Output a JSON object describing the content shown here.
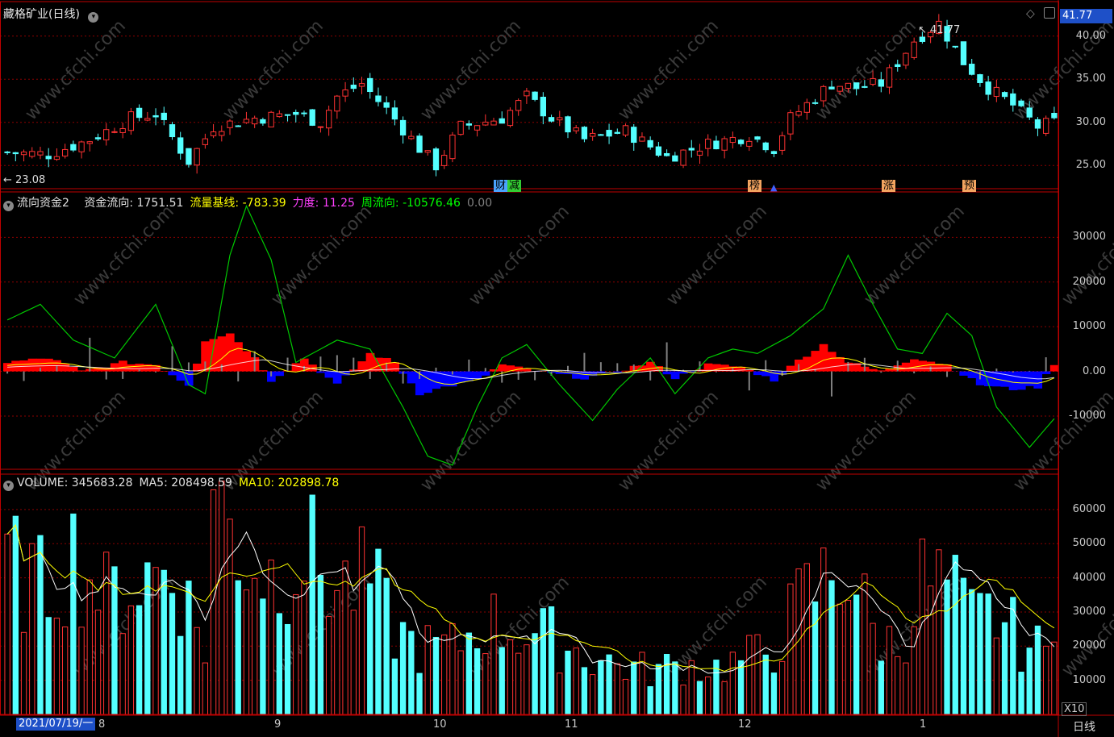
{
  "app": {
    "stock_title": "藏格矿业(日线)",
    "period_label": "日线",
    "zoom_label": "X10",
    "current_date": "2021/07/19/一",
    "watermark": "www.cfchi.com"
  },
  "price_panel": {
    "high_label": "41.77",
    "low_label": "23.08",
    "last_price_box": "41.77",
    "axis_ticks": [
      "40.00",
      "35.00",
      "30.00",
      "25.00"
    ],
    "markers": [
      {
        "text": "财",
        "color": "#4aa3ff"
      },
      {
        "text": "减",
        "color": "#33cc33"
      },
      {
        "text": "榜",
        "color": "#f4a460"
      },
      {
        "text": "涨",
        "color": "#f4a460"
      },
      {
        "text": "预",
        "color": "#f4a460"
      }
    ]
  },
  "flow_panel": {
    "title": "流向资金2",
    "items": [
      {
        "label": "资金流向: 1751.51",
        "color": "#e0e0e0"
      },
      {
        "label": "流量基线: -783.39",
        "color": "#ffff00"
      },
      {
        "label": "力度: 11.25",
        "color": "#ff40ff"
      },
      {
        "label": "周流向: -10576.46",
        "color": "#00ff00"
      },
      {
        "label": "0.00",
        "color": "#808080"
      }
    ],
    "axis_ticks": [
      "30000",
      "20000",
      "10000",
      "0.00",
      "-10000"
    ]
  },
  "volume_panel": {
    "items": [
      {
        "label": "VOLUME: 345683.28",
        "color": "#e0e0e0"
      },
      {
        "label": "MA5: 208498.59",
        "color": "#e0e0e0"
      },
      {
        "label": "MA10: 202898.78",
        "color": "#ffff00"
      }
    ],
    "axis_ticks": [
      "60000",
      "50000",
      "40000",
      "30000",
      "20000",
      "10000"
    ]
  },
  "x_axis": {
    "labels": [
      "8",
      "9",
      "10",
      "11",
      "12",
      "1"
    ]
  },
  "colors": {
    "up": "#ff3232",
    "down": "#54ffff",
    "grid": "#8b0000",
    "border": "#c00000",
    "flow_pos": "#ff0000",
    "flow_neg": "#0000ff",
    "week_line": "#00c800",
    "base_line": "#ffff00",
    "power_line": "#ffffff",
    "bars_gray": "#808080"
  },
  "chart_data": {
    "type": "candlestick",
    "n": 128,
    "price_range": [
      23.08,
      41.77
    ],
    "price_trend": [
      [
        0,
        26.5
      ],
      [
        5,
        26.3
      ],
      [
        10,
        28.0
      ],
      [
        15,
        30.5
      ],
      [
        18,
        31.0
      ],
      [
        22,
        25.5
      ],
      [
        25,
        29.5
      ],
      [
        30,
        30.5
      ],
      [
        35,
        31.0
      ],
      [
        38,
        30.0
      ],
      [
        40,
        33.0
      ],
      [
        43,
        34.5
      ],
      [
        46,
        31.5
      ],
      [
        50,
        27.0
      ],
      [
        52,
        25.0
      ],
      [
        55,
        29.5
      ],
      [
        60,
        30.5
      ],
      [
        63,
        33.0
      ],
      [
        66,
        30.5
      ],
      [
        70,
        28.0
      ],
      [
        75,
        29.0
      ],
      [
        80,
        26.0
      ],
      [
        85,
        27.5
      ],
      [
        90,
        28.5
      ],
      [
        93,
        27.0
      ],
      [
        95,
        30.5
      ],
      [
        100,
        34.5
      ],
      [
        103,
        34.0
      ],
      [
        106,
        34.5
      ],
      [
        110,
        39.5
      ],
      [
        113,
        41.5
      ],
      [
        116,
        37.0
      ],
      [
        119,
        34.0
      ],
      [
        122,
        32.0
      ],
      [
        125,
        29.5
      ],
      [
        127,
        30.0
      ]
    ],
    "flow_trend": [
      [
        0,
        2000
      ],
      [
        5,
        3000
      ],
      [
        9,
        0
      ],
      [
        14,
        2000
      ],
      [
        18,
        1500
      ],
      [
        22,
        -3000
      ],
      [
        24,
        7000
      ],
      [
        27,
        8500
      ],
      [
        30,
        3000
      ],
      [
        32,
        -2000
      ],
      [
        36,
        3000
      ],
      [
        40,
        -3000
      ],
      [
        44,
        4000
      ],
      [
        47,
        2000
      ],
      [
        50,
        -5000
      ],
      [
        53,
        -3500
      ],
      [
        57,
        -2000
      ],
      [
        60,
        1500
      ],
      [
        64,
        0
      ],
      [
        70,
        -1500
      ],
      [
        74,
        0
      ],
      [
        78,
        2000
      ],
      [
        81,
        -1500
      ],
      [
        85,
        1500
      ],
      [
        89,
        1000
      ],
      [
        93,
        -2000
      ],
      [
        96,
        2500
      ],
      [
        99,
        6000
      ],
      [
        102,
        2000
      ],
      [
        106,
        0
      ],
      [
        110,
        3000
      ],
      [
        114,
        1500
      ],
      [
        118,
        -3000
      ],
      [
        122,
        -4000
      ],
      [
        125,
        -3500
      ],
      [
        127,
        1751.51
      ]
    ],
    "week_trend": [
      [
        0,
        11500
      ],
      [
        4,
        15000
      ],
      [
        8,
        7000
      ],
      [
        13,
        3000
      ],
      [
        18,
        15000
      ],
      [
        22,
        -3000
      ],
      [
        24,
        -5000
      ],
      [
        27,
        26000
      ],
      [
        29,
        37000
      ],
      [
        32,
        25000
      ],
      [
        35,
        2000
      ],
      [
        40,
        7000
      ],
      [
        44,
        5000
      ],
      [
        48,
        -8000
      ],
      [
        51,
        -19000
      ],
      [
        54,
        -21000
      ],
      [
        57,
        -8000
      ],
      [
        60,
        3000
      ],
      [
        63,
        6000
      ],
      [
        67,
        -3000
      ],
      [
        71,
        -11000
      ],
      [
        74,
        -4000
      ],
      [
        78,
        3000
      ],
      [
        81,
        -5000
      ],
      [
        85,
        3000
      ],
      [
        88,
        5000
      ],
      [
        91,
        4000
      ],
      [
        95,
        8000
      ],
      [
        99,
        14000
      ],
      [
        102,
        26000
      ],
      [
        105,
        15000
      ],
      [
        108,
        5000
      ],
      [
        111,
        4000
      ],
      [
        114,
        13000
      ],
      [
        117,
        8000
      ],
      [
        120,
        -8000
      ],
      [
        124,
        -17000
      ],
      [
        127,
        -10576.46
      ]
    ],
    "volume_range": [
      0,
      68000
    ],
    "volume_trend": [
      [
        0,
        45000
      ],
      [
        4,
        38000
      ],
      [
        8,
        48000
      ],
      [
        12,
        35000
      ],
      [
        16,
        40000
      ],
      [
        20,
        45000
      ],
      [
        24,
        20000
      ],
      [
        25,
        65000
      ],
      [
        29,
        48000
      ],
      [
        32,
        42000
      ],
      [
        36,
        50000
      ],
      [
        40,
        38000
      ],
      [
        44,
        40000
      ],
      [
        47,
        25000
      ],
      [
        50,
        20000
      ],
      [
        54,
        20000
      ],
      [
        58,
        28000
      ],
      [
        62,
        25000
      ],
      [
        66,
        23000
      ],
      [
        70,
        18000
      ],
      [
        74,
        15000
      ],
      [
        78,
        13000
      ],
      [
        82,
        15000
      ],
      [
        86,
        14000
      ],
      [
        90,
        17000
      ],
      [
        93,
        20000
      ],
      [
        96,
        33000
      ],
      [
        99,
        40000
      ],
      [
        102,
        45000
      ],
      [
        105,
        25000
      ],
      [
        108,
        20000
      ],
      [
        111,
        40000
      ],
      [
        114,
        38000
      ],
      [
        117,
        28000
      ],
      [
        120,
        30000
      ],
      [
        123,
        22000
      ],
      [
        126,
        18000
      ],
      [
        127,
        34568.328
      ]
    ]
  }
}
